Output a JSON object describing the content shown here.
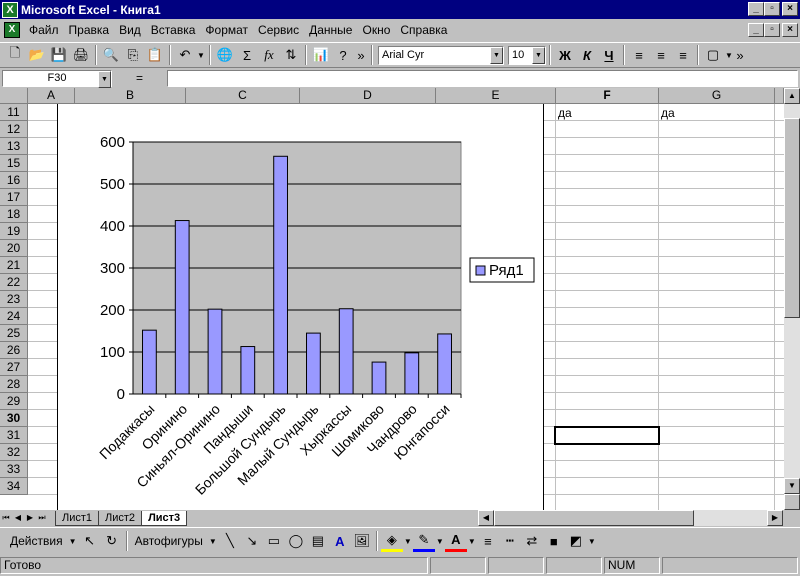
{
  "window": {
    "title": "Microsoft Excel - Книга1"
  },
  "menu": [
    "Файл",
    "Правка",
    "Вид",
    "Вставка",
    "Формат",
    "Сервис",
    "Данные",
    "Окно",
    "Справка"
  ],
  "toolbar": {
    "font": "Arial Cyr",
    "size": "10",
    "bold": "Ж",
    "italic": "К",
    "underline": "Ч",
    "sigma": "Σ",
    "fx": "fx",
    "more": "»"
  },
  "formula_bar": {
    "name_box": "F30",
    "equals": "="
  },
  "columns": [
    "A",
    "B",
    "C",
    "D",
    "E",
    "F",
    "G"
  ],
  "rows": [
    "11",
    "12",
    "13",
    "15",
    "16",
    "17",
    "18",
    "19",
    "20",
    "21",
    "22",
    "23",
    "24",
    "25",
    "26",
    "27",
    "28",
    "29",
    "30",
    "31",
    "32",
    "33",
    "34"
  ],
  "cells": {
    "f12": "да",
    "g12": "да"
  },
  "chart_data": {
    "type": "bar",
    "categories": [
      "Подаккасы",
      "Оринино",
      "Синьял-Оринино",
      "Пандыши",
      "Большой Сундырь",
      "Малый Сундырь",
      "Хыркассы",
      "Шомиково",
      "Чандрово",
      "Юнгапосси"
    ],
    "series": [
      {
        "name": "Ряд1",
        "values": [
          152,
          413,
          202,
          113,
          566,
          145,
          203,
          76,
          98,
          143
        ]
      }
    ],
    "ylim": [
      0,
      600
    ],
    "yticks": [
      "0",
      "100",
      "200",
      "300",
      "400",
      "500",
      "600"
    ],
    "grid": true,
    "legend": "right",
    "bar_color": "#9999ff",
    "plot_bg": "#c0c0c0"
  },
  "sheet_tabs": [
    "Лист1",
    "Лист2",
    "Лист3"
  ],
  "active_tab": "Лист3",
  "drawing": {
    "actions": "Действия",
    "autoshapes": "Автофигуры"
  },
  "status": {
    "ready": "Готово",
    "num": "NUM"
  }
}
